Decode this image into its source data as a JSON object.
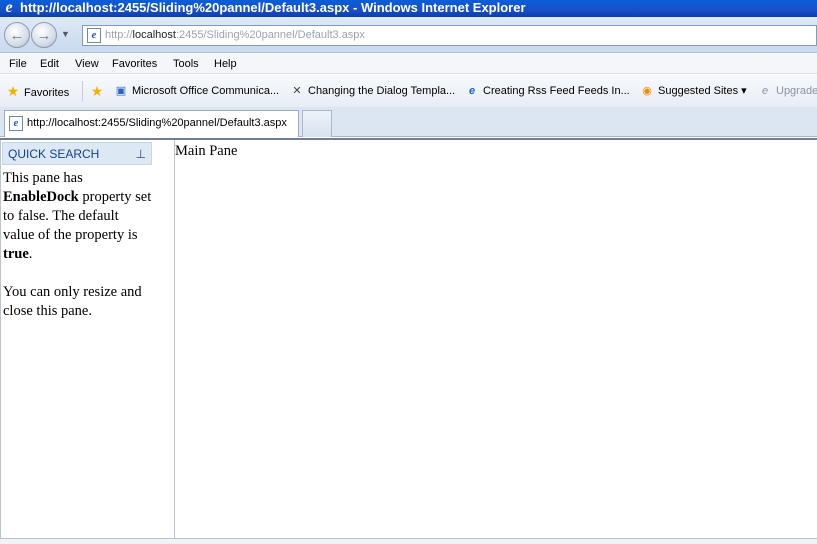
{
  "window": {
    "title": "http://localhost:2455/Sliding%20pannel/Default3.aspx - Windows Internet Explorer"
  },
  "address": {
    "prefix": "http://",
    "host": "localhost",
    "rest": ":2455/Sliding%20pannel/Default3.aspx"
  },
  "menu": [
    "File",
    "Edit",
    "View",
    "Favorites",
    "Tools",
    "Help"
  ],
  "favorites_bar": {
    "favorites_label": "Favorites",
    "items": [
      "Microsoft Office Communica...",
      "Changing the Dialog Templa...",
      "Creating Rss Feed Feeds In...",
      "Suggested Sites ▾",
      "Upgrade"
    ]
  },
  "tab": {
    "label": "http://localhost:2455/Sliding%20pannel/Default3.aspx"
  },
  "side_pane": {
    "header": "QUICK SEARCH",
    "para1_a": "This pane has ",
    "para1_b": "EnableDock",
    "para1_c": " property set to false. The default value of the property is ",
    "para1_d": "true",
    "para1_e": ".",
    "para2": "You can only resize and close this pane."
  },
  "main_pane": {
    "text": "Main Pane"
  },
  "colors": {
    "title_bar": "#0a5fd8",
    "pane_header_bg": "#dde8f5",
    "pane_header_text": "#15428b"
  }
}
